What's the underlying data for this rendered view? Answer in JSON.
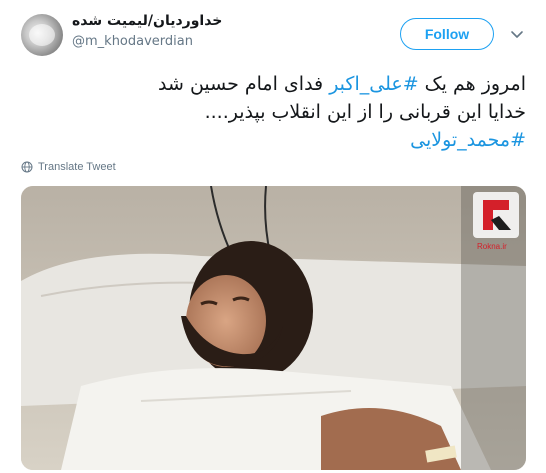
{
  "author": {
    "display_name": "خداوردیان/لیمیت شده",
    "handle": "@m_khodaverdian"
  },
  "follow_button": {
    "label": "Follow"
  },
  "tweet": {
    "line1_part1": "امروز هم یک ",
    "line1_hashtag": "#علی_اکبر",
    "line1_part2": " فدای امام حسین شد",
    "line2": "خدایا این قربانی را از این انقلاب بپذیر....",
    "line3_hashtag": "#محمد_تولایی"
  },
  "translate": {
    "label": "Translate Tweet"
  },
  "media": {
    "watermark": "Rokna.ir"
  },
  "colors": {
    "accent": "#1da1f2",
    "hashtag": "#1b95e0",
    "muted": "#657786"
  },
  "icons": {
    "translate": "globe-icon",
    "menu": "chevron-down-icon"
  }
}
